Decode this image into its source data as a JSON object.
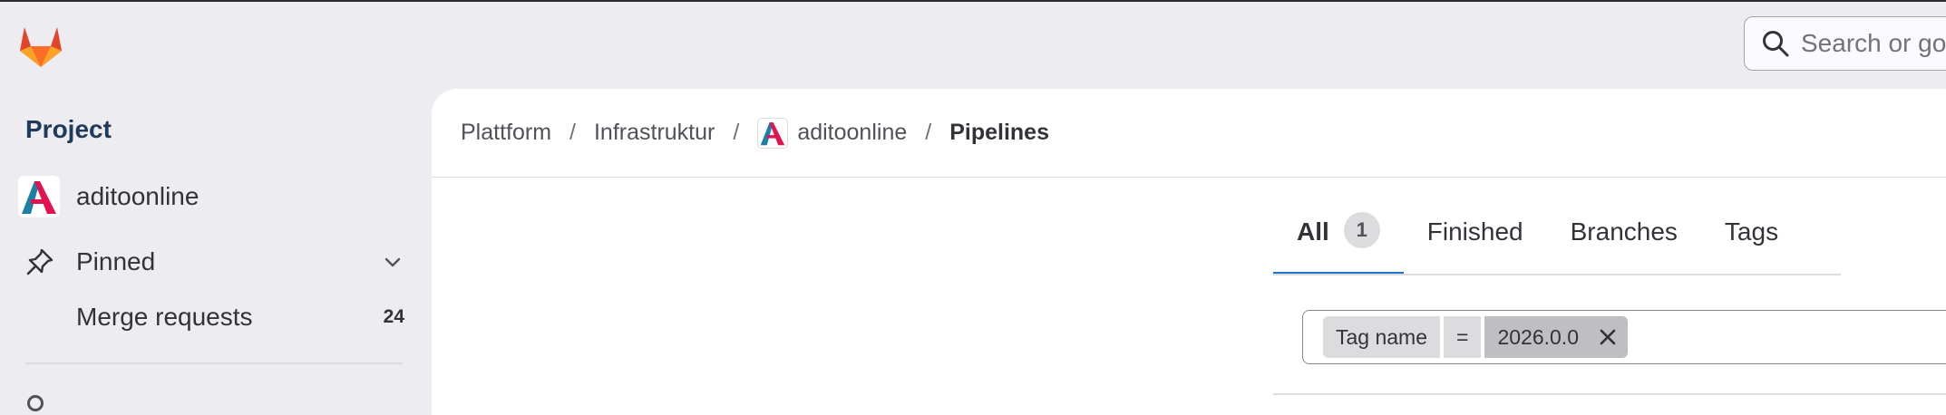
{
  "brand": {
    "logo": "gitlab-tanuki-logo"
  },
  "search": {
    "placeholder": "Search or go"
  },
  "sidebar": {
    "title": "Project",
    "project_name": "aditoonline",
    "pinned_label": "Pinned",
    "items": [
      {
        "label": "Merge requests",
        "count": "24"
      }
    ]
  },
  "breadcrumb": {
    "items": [
      "Plattform",
      "Infrastruktur",
      "aditoonline",
      "Pipelines"
    ],
    "separator": "/"
  },
  "tabs": [
    {
      "label": "All",
      "badge": "1",
      "active": true
    },
    {
      "label": "Finished"
    },
    {
      "label": "Branches"
    },
    {
      "label": "Tags"
    }
  ],
  "filter": {
    "field": "Tag name",
    "operator": "=",
    "value": "2026.0.0"
  },
  "colors": {
    "accent": "#1f75cb",
    "sidebar_title": "#1f3a5a",
    "background": "#ececf1",
    "logo_orange": "#e24329",
    "logo_light": "#fca326"
  }
}
